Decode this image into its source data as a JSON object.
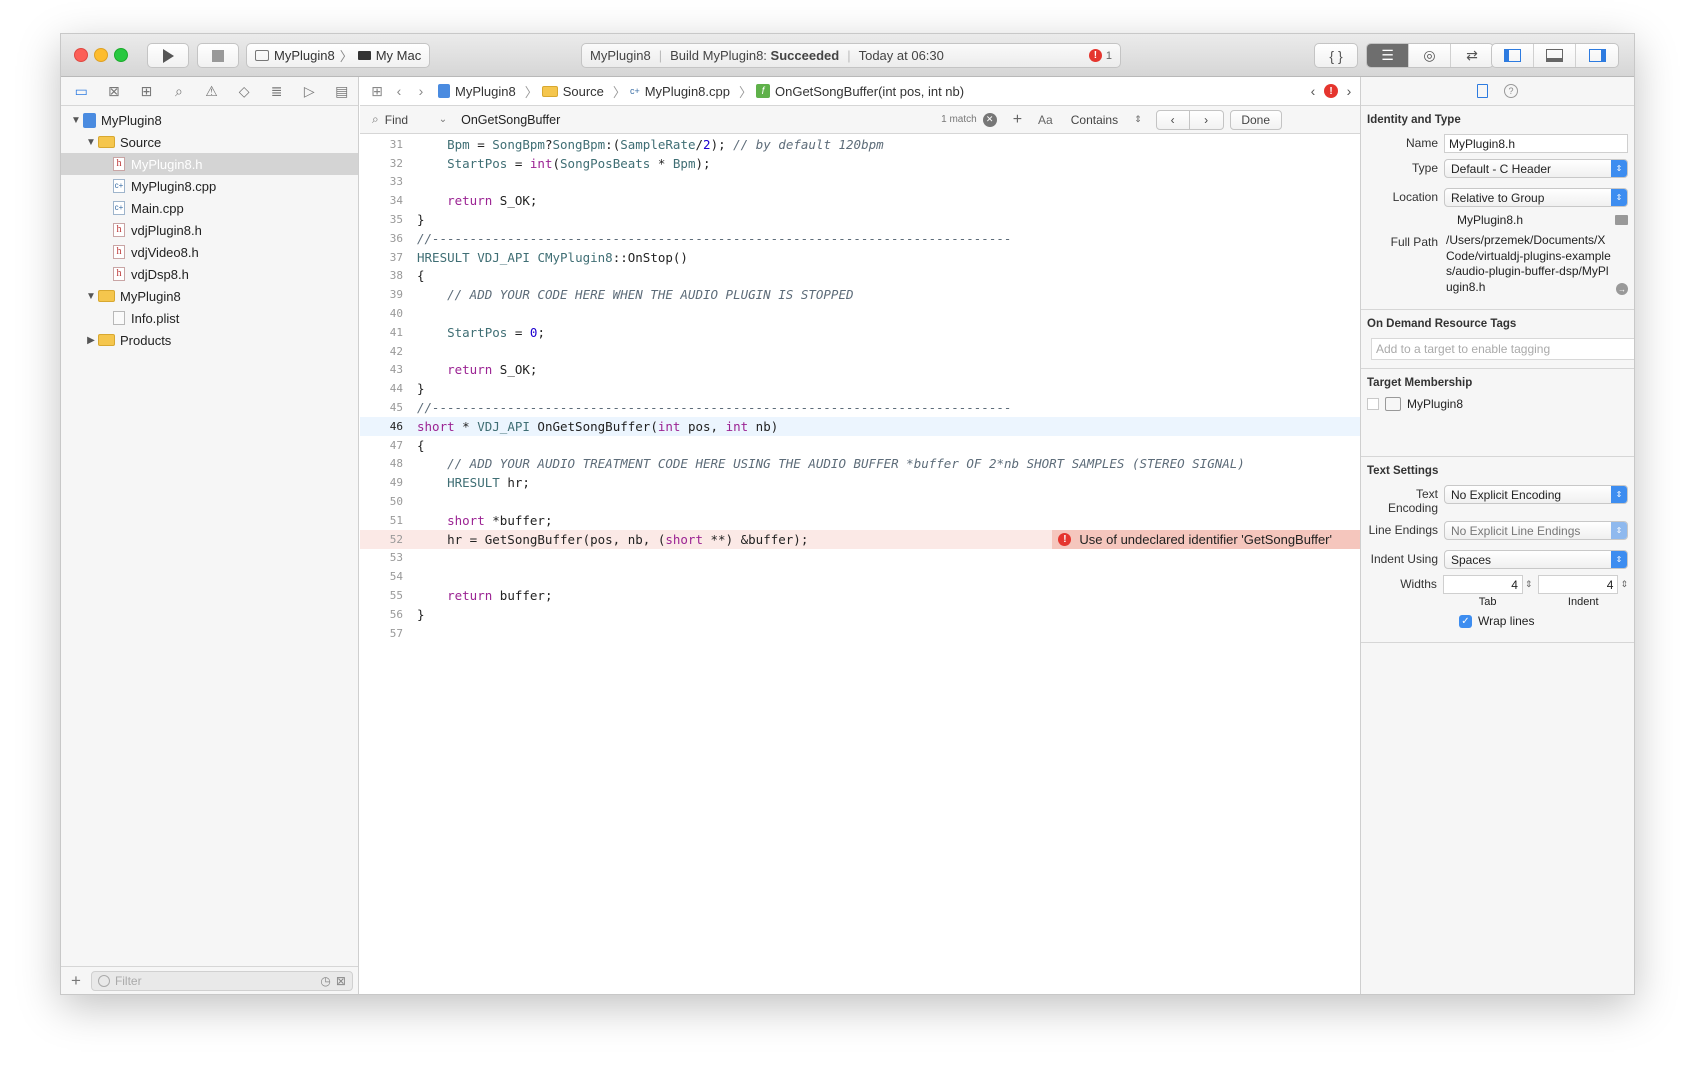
{
  "toolbar": {
    "scheme_name": "MyPlugin8",
    "destination": "My Mac",
    "status_project": "MyPlugin8",
    "status_build_prefix": "Build MyPlugin8:",
    "status_build_result": "Succeeded",
    "status_time": "Today at 06:30",
    "error_count": "1",
    "editor_buttons": [
      "{ }"
    ],
    "colors": {
      "error": "#e5352e",
      "accent": "#2d7be0"
    }
  },
  "navigator": {
    "tree": [
      {
        "label": "MyPlugin8",
        "type": "project",
        "indent": 0,
        "disclosure": "▼"
      },
      {
        "label": "Source",
        "type": "folder",
        "indent": 1,
        "disclosure": "▼"
      },
      {
        "label": "MyPlugin8.h",
        "type": "h",
        "indent": 2,
        "selected": true
      },
      {
        "label": "MyPlugin8.cpp",
        "type": "cpp",
        "indent": 2
      },
      {
        "label": "Main.cpp",
        "type": "cpp",
        "indent": 2
      },
      {
        "label": "vdjPlugin8.h",
        "type": "h",
        "indent": 2
      },
      {
        "label": "vdjVideo8.h",
        "type": "h",
        "indent": 2
      },
      {
        "label": "vdjDsp8.h",
        "type": "h",
        "indent": 2
      },
      {
        "label": "MyPlugin8",
        "type": "folder",
        "indent": 1,
        "disclosure": "▼"
      },
      {
        "label": "Info.plist",
        "type": "plist",
        "indent": 2
      },
      {
        "label": "Products",
        "type": "folder",
        "indent": 1,
        "disclosure": "▶"
      }
    ],
    "filter_placeholder": "Filter"
  },
  "jumpbar": {
    "crumbs": [
      "MyPlugin8",
      "Source",
      "MyPlugin8.cpp",
      "OnGetSongBuffer(int pos, int nb)"
    ]
  },
  "findbar": {
    "mode": "Find",
    "query": "OnGetSongBuffer",
    "matches": "1 match",
    "case_label": "Aa",
    "match_type": "Contains",
    "done_label": "Done"
  },
  "code": {
    "lines": [
      {
        "n": "31",
        "html": "    <span class=\"ty\">Bpm</span> = <span class=\"ty\">SongBpm</span>?<span class=\"ty\">SongBpm</span>:(<span class=\"ty\">SampleRate</span>/<span class=\"nm\">2</span>); <span class=\"cm\">// by default 120bpm</span>"
      },
      {
        "n": "32",
        "html": "    <span class=\"ty\">StartPos</span> = <span class=\"kw\">int</span>(<span class=\"ty\">SongPosBeats</span> * <span class=\"ty\">Bpm</span>);"
      },
      {
        "n": "33",
        "html": ""
      },
      {
        "n": "34",
        "html": "    <span class=\"kw\">return</span> S_OK;"
      },
      {
        "n": "35",
        "html": "}"
      },
      {
        "n": "36",
        "html": "<span class=\"cm\">//-----------------------------------------------------------------------------</span>"
      },
      {
        "n": "37",
        "html": "<span class=\"ty\">HRESULT</span> <span class=\"ty\">VDJ_API</span> <span class=\"ty\">CMyPlugin8</span>::OnStop()"
      },
      {
        "n": "38",
        "html": "{"
      },
      {
        "n": "39",
        "html": "    <span class=\"cm\">// ADD YOUR CODE HERE WHEN THE AUDIO PLUGIN IS STOPPED</span>"
      },
      {
        "n": "40",
        "html": ""
      },
      {
        "n": "41",
        "html": "    <span class=\"ty\">StartPos</span> = <span class=\"nm\">0</span>;"
      },
      {
        "n": "42",
        "html": ""
      },
      {
        "n": "43",
        "html": "    <span class=\"kw\">return</span> S_OK;"
      },
      {
        "n": "44",
        "html": "}"
      },
      {
        "n": "45",
        "html": "<span class=\"cm\">//-----------------------------------------------------------------------------</span>"
      },
      {
        "n": "46",
        "html": "<span class=\"kw\">short</span> * <span class=\"ty\">VDJ_API</span> OnGetSongBuffer(<span class=\"kw\">int</span> pos, <span class=\"kw\">int</span> nb)",
        "current": true
      },
      {
        "n": "47",
        "html": "{"
      },
      {
        "n": "48",
        "html": "    <span class=\"cm\">// ADD YOUR AUDIO TREATMENT CODE HERE USING THE AUDIO BUFFER *buffer OF 2*nb SHORT SAMPLES (STEREO SIGNAL)</span>"
      },
      {
        "n": "49",
        "html": "    <span class=\"ty\">HRESULT</span> hr;"
      },
      {
        "n": "50",
        "html": ""
      },
      {
        "n": "51",
        "html": "    <span class=\"kw\">short</span> *buffer;"
      },
      {
        "n": "52",
        "html": "    hr = GetSongBuffer(pos, nb, (<span class=\"kw\">short</span> **) &amp;buffer);",
        "error": true
      },
      {
        "n": "53",
        "html": ""
      },
      {
        "n": "54",
        "html": ""
      },
      {
        "n": "55",
        "html": "    <span class=\"kw\">return</span> buffer;"
      },
      {
        "n": "56",
        "html": "}"
      },
      {
        "n": "57",
        "html": ""
      }
    ],
    "error_message": "Use of undeclared identifier 'GetSongBuffer'"
  },
  "inspector": {
    "identity_title": "Identity and Type",
    "name_label": "Name",
    "name_value": "MyPlugin8.h",
    "type_label": "Type",
    "type_value": "Default - C Header",
    "location_label": "Location",
    "location_value": "Relative to Group",
    "location_file": "MyPlugin8.h",
    "fullpath_label": "Full Path",
    "fullpath_value": "/Users/przemek/Documents/XCode/virtualdj-plugins-examples/audio-plugin-buffer-dsp/MyPlugin8.h",
    "ondemand_title": "On Demand Resource Tags",
    "tags_placeholder": "Add to a target to enable tagging",
    "membership_title": "Target Membership",
    "membership_target": "MyPlugin8",
    "text_settings_title": "Text Settings",
    "encoding_label": "Text Encoding",
    "encoding_value": "No Explicit Encoding",
    "line_endings_label": "Line Endings",
    "line_endings_value": "No Explicit Line Endings",
    "indent_using_label": "Indent Using",
    "indent_using_value": "Spaces",
    "widths_label": "Widths",
    "tab_width": "4",
    "indent_width": "4",
    "tab_caption": "Tab",
    "indent_caption": "Indent",
    "wrap_label": "Wrap lines",
    "wrap_checked": true
  }
}
